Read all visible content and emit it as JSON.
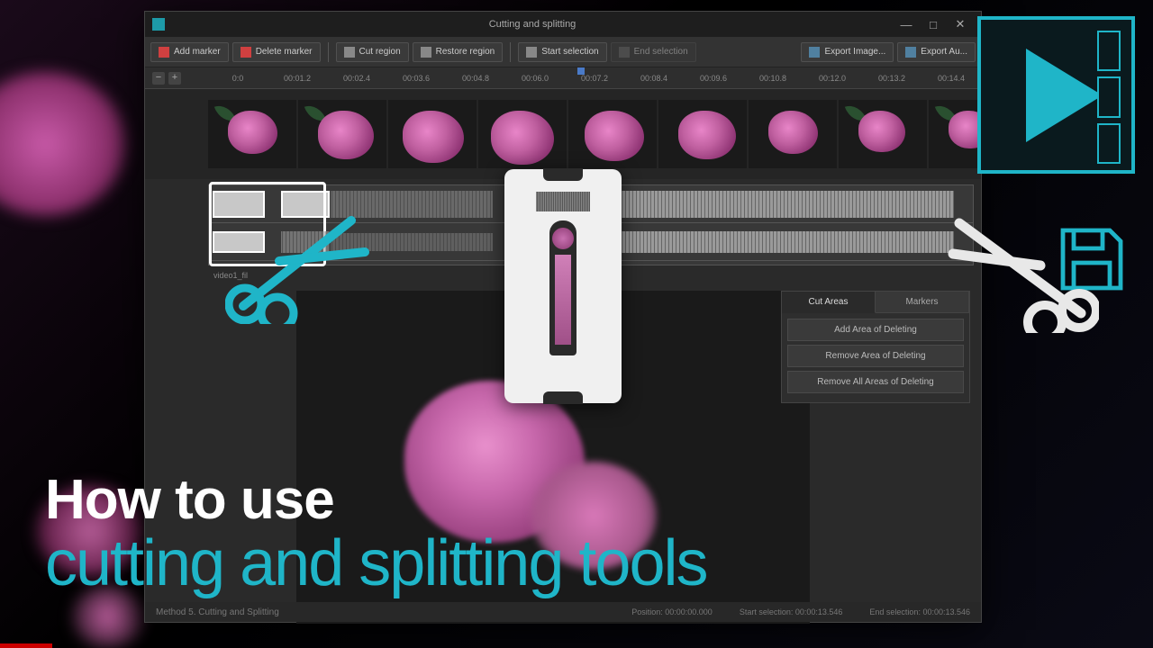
{
  "window": {
    "title": "Cutting and splitting"
  },
  "toolbar": {
    "add_marker": "Add marker",
    "delete_marker": "Delete marker",
    "cut_region": "Cut region",
    "restore_region": "Restore region",
    "start_selection": "Start selection",
    "end_selection": "End selection",
    "export_image": "Export Image...",
    "export_audio": "Export Au..."
  },
  "ruler": {
    "ticks": [
      "0:0",
      "00:01.2",
      "00:02.4",
      "00:03.6",
      "00:04.8",
      "00:06.0",
      "00:07.2",
      "00:08.4",
      "00:09.6",
      "00:10.8",
      "00:12.0",
      "00:13.2",
      "00:14.4"
    ]
  },
  "track_label": "video1_fil",
  "side": {
    "tabs": {
      "cut_areas": "Cut Areas",
      "markers": "Markers"
    },
    "items": {
      "add": "Add Area of Deleting",
      "remove": "Remove Area of Deleting",
      "remove_all": "Remove All Areas of Deleting"
    }
  },
  "status": {
    "method": "Method 5. Cutting and Splitting",
    "position": "Position: 00:00:00.000",
    "start_sel": "Start selection: 00:00:13.546",
    "end_sel": "End selection: 00:00:13.546"
  },
  "headline": {
    "l1": "How to use",
    "l2": "cutting and splitting tools"
  },
  "colors": {
    "accent": "#1fb5c8"
  }
}
